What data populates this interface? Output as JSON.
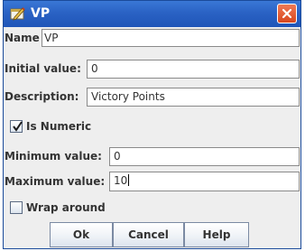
{
  "window": {
    "title": "VP",
    "title_icon": "edit-icon",
    "close_icon": "close-icon"
  },
  "form": {
    "name_label": "Name",
    "name_value": "VP",
    "initial_label": "Initial value:",
    "initial_value": "0",
    "description_label": "Description:",
    "description_value": "Victory Points",
    "is_numeric_label": "Is Numeric",
    "is_numeric_checked": true,
    "minimum_label": "Minimum value:",
    "minimum_value": "0",
    "maximum_label": "Maximum value:",
    "maximum_value": "10",
    "wrap_label": "Wrap around",
    "wrap_checked": false
  },
  "buttons": {
    "ok": "Ok",
    "cancel": "Cancel",
    "help": "Help"
  }
}
